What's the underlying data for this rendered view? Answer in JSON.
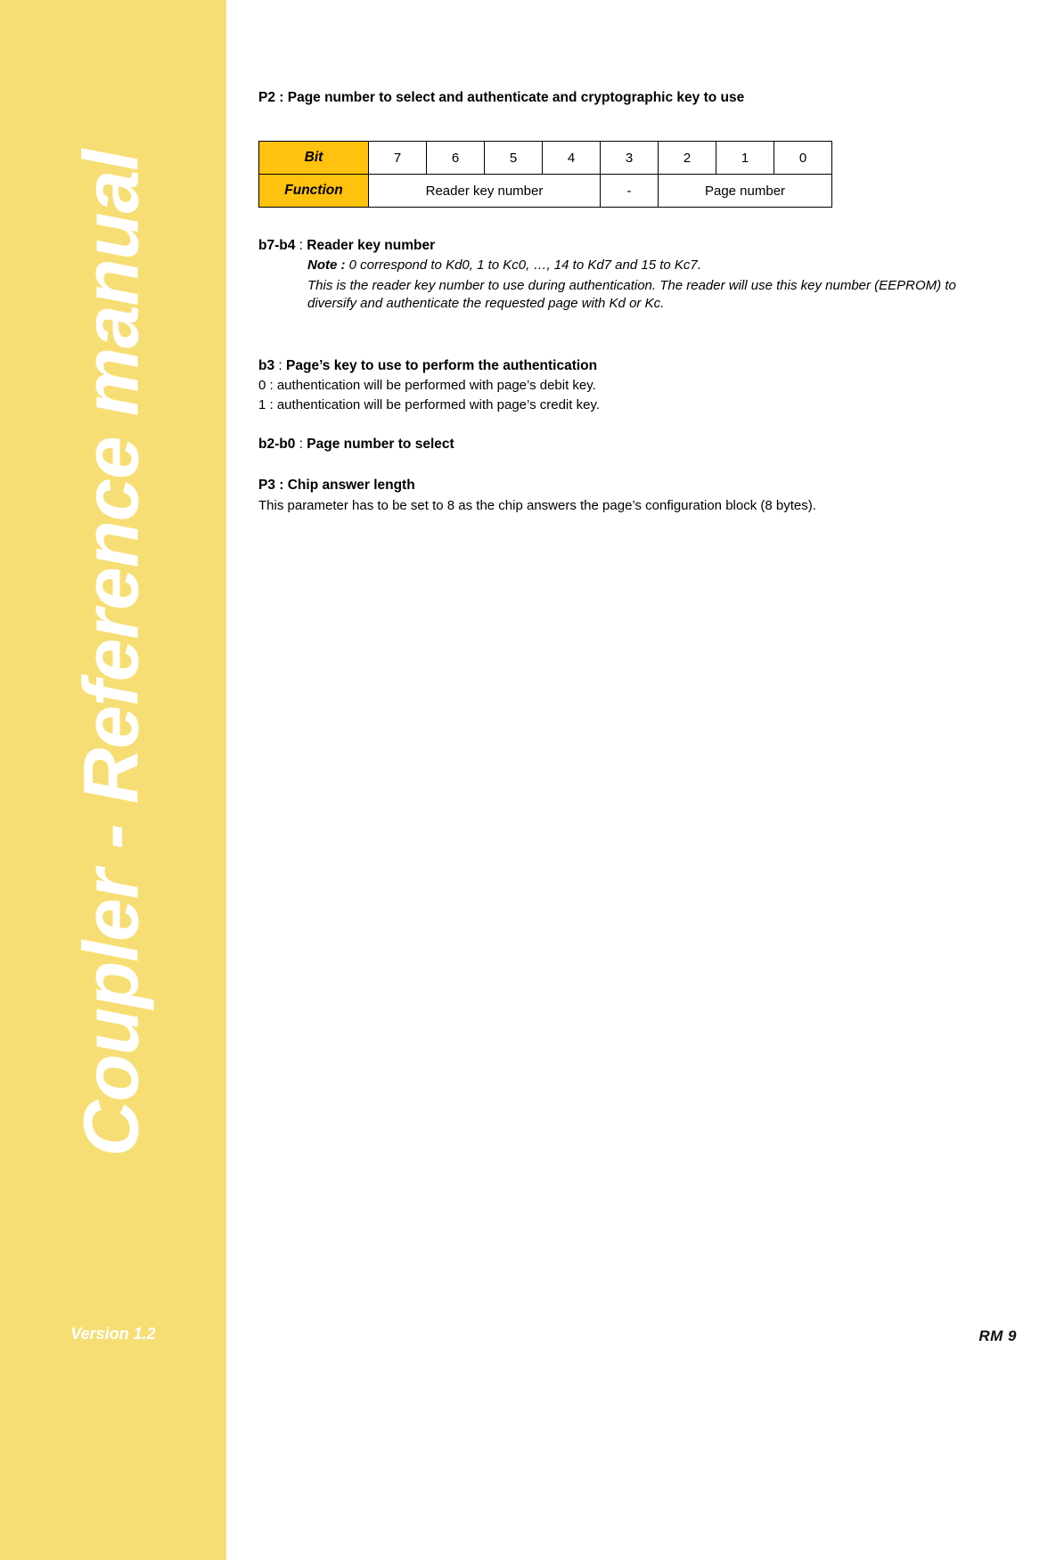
{
  "sidebar": {
    "vertical_title": "Coupler - Reference manual",
    "version": "Version 1.2",
    "background_color": "#F7DE74",
    "text_color": "#FFFFFF"
  },
  "footer": {
    "page_ref": "RM 9"
  },
  "document": {
    "p2_heading": "P2 : Page number to select and authenticate and cryptographic key to use",
    "sections": [
      {
        "id": "b7-b4",
        "heading_prefix": "b7-b4",
        "heading_separator": " : ",
        "heading_text": "Reader key number",
        "note_label": "Note :",
        "note_text": " 0 correspond to Kd0, 1 to Kc0, …, 14 to Kd7 and 15 to Kc7.",
        "body_italic": "This is the reader key number to use during authentication. The reader will use this key number (EEPROM) to diversify and authenticate the requested page with Kd or Kc."
      },
      {
        "id": "b3",
        "heading_prefix": "b3",
        "heading_separator": " : ",
        "heading_text": "Page’s key to use to perform the authentication",
        "line_0": "0 : authentication will be performed with page’s debit key.",
        "line_1": "1 : authentication will be performed with page’s credit key."
      },
      {
        "id": "b2-b0",
        "heading_prefix": "b2-b0",
        "heading_separator": " : ",
        "heading_text": "Page number to select"
      },
      {
        "id": "p3",
        "heading_prefix": "P3 : Chip answer length",
        "body": "This parameter has to be set to 8 as the chip answers the page’s configuration block (8 bytes)."
      }
    ]
  },
  "bit_table": {
    "header_color": "#FFC20E",
    "row_labels": [
      "Bit",
      "Function"
    ],
    "bits": [
      "7",
      "6",
      "5",
      "4",
      "3",
      "2",
      "1",
      "0"
    ],
    "functions": [
      {
        "label": "Reader key number",
        "span": 4
      },
      {
        "label": "-",
        "span": 1
      },
      {
        "label": "Page number",
        "span": 3
      }
    ]
  }
}
